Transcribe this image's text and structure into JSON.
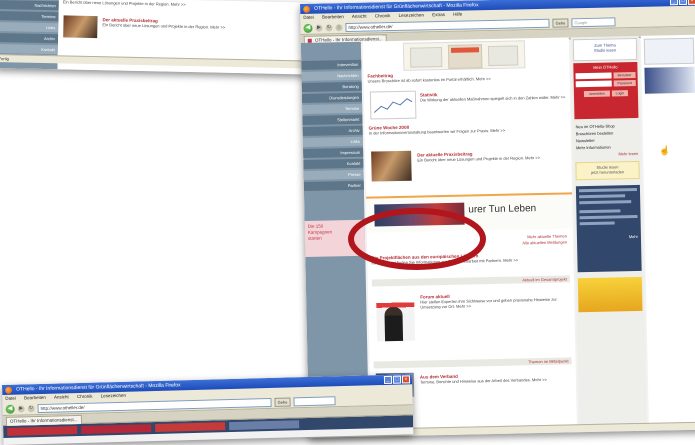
{
  "window": {
    "title": "OTHello - Ihr Informationsdienst für Grünflächenwirtschaft - Mozilla Firefox",
    "menu": [
      "Datei",
      "Bearbeiten",
      "Ansicht",
      "Chronik",
      "Lesezeichen",
      "Extras",
      "Hilfe"
    ],
    "url": "http://www.otheller.de/",
    "go": "Gehe",
    "search_placeholder": "Google",
    "tab": "OTHello - Ihr Informationsdienst...",
    "status": "Fertig"
  },
  "sidebar": {
    "items": [
      "Intervention",
      "Nachrichten",
      "Beratung",
      "Dienstleistungen",
      "Termine",
      "Stellenmarkt",
      "Archiv",
      "Links",
      "Impressum",
      "Kontakt",
      "Presse",
      "Partner"
    ],
    "promo": [
      "Die 150",
      "Kampagnen",
      "starten"
    ]
  },
  "content": {
    "news": [
      {
        "heading": "Fachbeitrag",
        "text": "Unsere Broschüre ist ab sofort kostenlos im Portal erhältlich.  Mehr >>"
      },
      {
        "heading": "Statistik",
        "text": "Die Wirkung der aktuellen Maßnahmen spiegelt sich in den Zahlen wider.  Mehr >>"
      },
      {
        "heading": "Grüne Woche 2008",
        "text": "In der Informationsveranstaltung beantworten wir Fragen zur Praxis.  Mehr >>"
      },
      {
        "heading": "Der aktuelle Praxisbeitrag",
        "text": "Ein Bericht über neue Lösungen und Projekte in der Region.  Mehr >>"
      }
    ],
    "banner_text": "urer Tun Leben",
    "links": [
      "Mehr aktuelle Themen",
      "Alle aktuellen Meldungen"
    ],
    "section": {
      "heading": "Die Projektflächen aus den europäischen Ländern",
      "text": "Im Fachportal finden Sie Informationen zur Zusammenarbeit mit Partnern.  Mehr >>"
    },
    "section2_title": "Aktuell im Gesamtprojekt",
    "section3": {
      "heading": "Forum aktuell",
      "text": "Hier stellen Experten ihre Sichtweise vor und geben praxisnahe Hinweise zur Umsetzung vor Ort.  Mehr >>"
    },
    "section4_title": "Themen im Mittelpunkt",
    "section5": {
      "heading": "Aus dem Verband",
      "text": "Termine, Berichte und Hinweise aus der Arbeit des Verbandes.  Mehr >>"
    }
  },
  "rightcol": {
    "promo": [
      "Zum Thema",
      "Studie lesen"
    ],
    "login_title": "Mein OTHello",
    "login_labels": [
      "Benutzer",
      "Passwort"
    ],
    "login_buttons": [
      "Anmelden",
      "Login"
    ],
    "links": [
      "Neu im OTHello-Shop",
      "Broschüren bestellen",
      "Newsletter",
      "Mehr Informationen"
    ],
    "more": "Mehr lesen",
    "box": [
      "Studie lesen",
      "jetzt herunterladen"
    ],
    "mehr": "Mehr"
  },
  "topshot": {
    "nav": [
      "Nachrichten",
      "Termine",
      "Links",
      "Archiv",
      "Kontakt"
    ],
    "heading": "Der aktuelle Praxisbeitrag",
    "text": "Ein Bericht über neue Lösungen und Projekte in der Region.  Mehr >>",
    "status": "Fertig"
  },
  "bottomshot": {
    "title": "OTHello - Ihr Informationsdienst für Grünflächenwirtschaft - Mozilla Firefox",
    "url": "http://www.otheller.de/",
    "tab": "OTHello - Ihr Informationsdienst..."
  },
  "colors": {
    "accent": "#b0161c",
    "highlight": "#b0161c",
    "nav": "#5d7689",
    "titlebar": "#2a5bc9"
  }
}
